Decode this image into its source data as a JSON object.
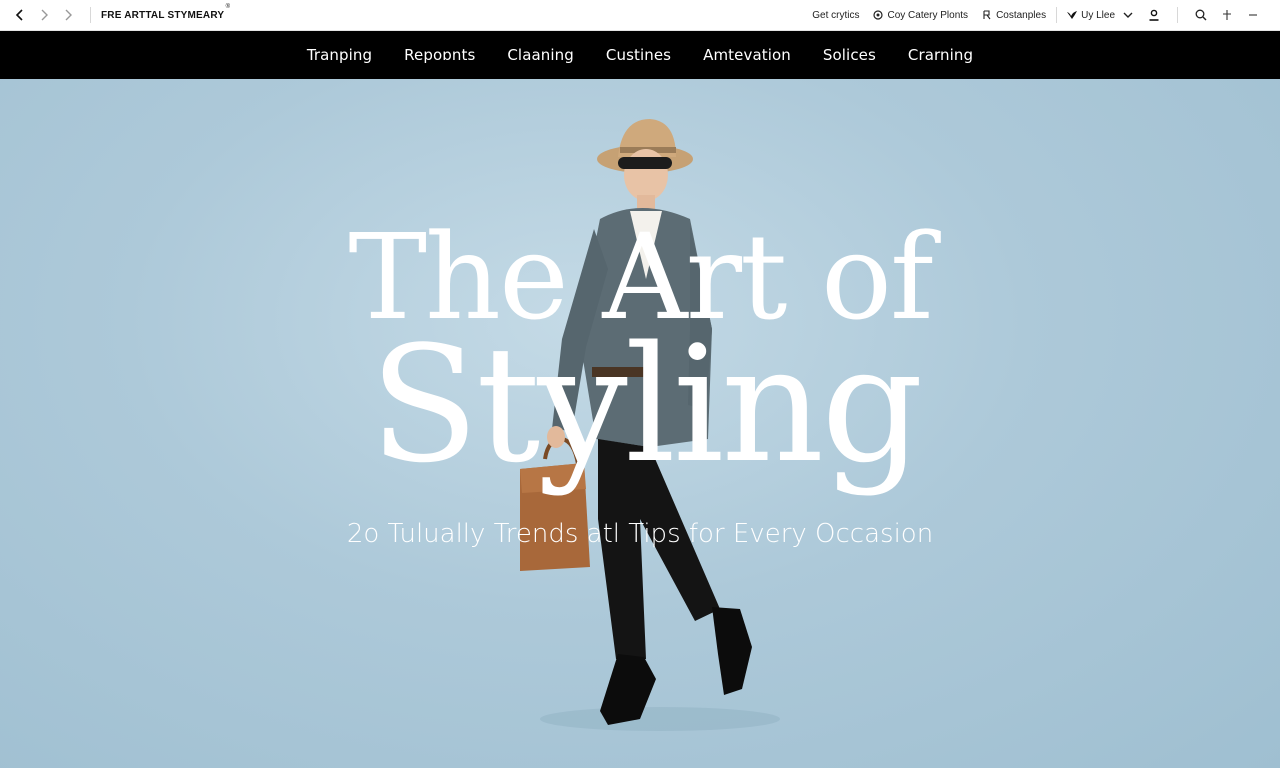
{
  "browser": {
    "site_title": "FRE ARTTAL STYMEARY",
    "title_mark": "®"
  },
  "utility": {
    "get_links": "Get crytics",
    "categories": "Coy Catery Plonts",
    "costamples": "Costanples",
    "user_label": "Uy Llee"
  },
  "nav": {
    "items": [
      "Tranping",
      "Repoɒnts",
      "Claaning",
      "Custines",
      "Amtevation",
      "Solices",
      "Crarning"
    ]
  },
  "hero": {
    "headline_line1": "The Art of",
    "headline_line2": "Styling",
    "subheadline": "2o Tulually Trends atl Tips for Every Occasion"
  },
  "colors": {
    "nav_bg": "#000000",
    "hero_bg": "#adc9d9",
    "headline": "#ffffff"
  },
  "icons": {
    "back": "chevron-left-icon",
    "forward": "chevron-right-icon",
    "forward2": "chevron-right-icon",
    "categories": "circle-icon",
    "costamples": "tag-icon",
    "user": "bird-icon",
    "dropdown": "chevron-down-icon",
    "account": "person-icon",
    "search": "search-icon",
    "add": "plus-icon",
    "menu": "minus-icon"
  }
}
